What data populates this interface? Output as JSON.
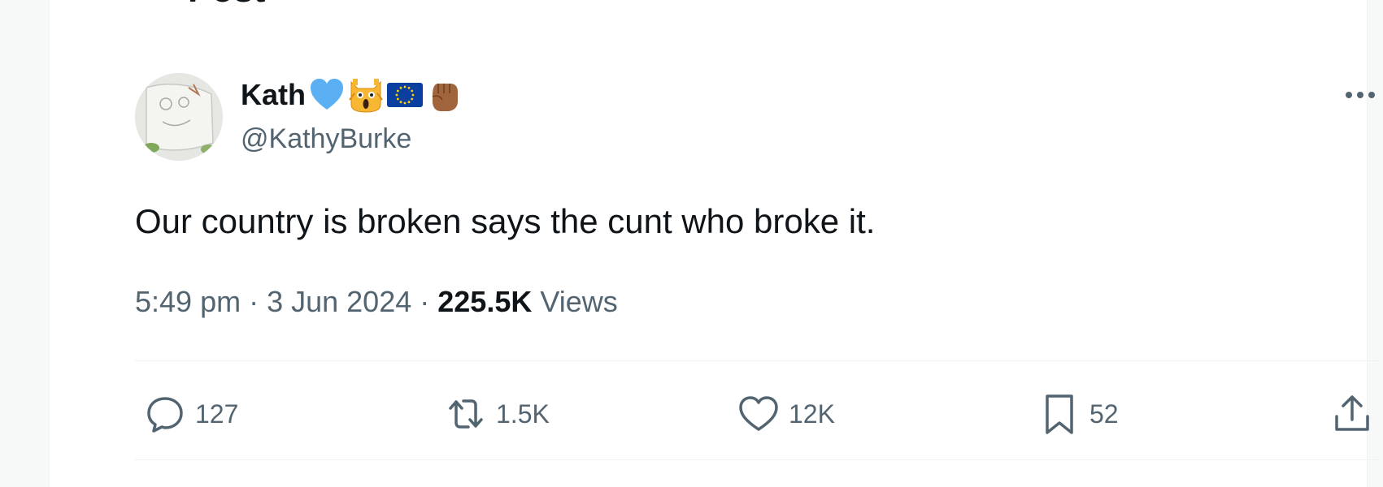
{
  "header": {
    "title": "Post"
  },
  "author": {
    "name": "Kath",
    "handle": "@KathyBurke",
    "badges": [
      "blue-heart-icon",
      "screaming-cat-icon",
      "eu-flag-icon",
      "raised-fist-icon"
    ]
  },
  "tweet": {
    "text": "Our country is broken says the cunt who broke it.",
    "time": "5:49 pm",
    "date": "3 Jun 2024",
    "views_count": "225.5K",
    "views_label": "Views"
  },
  "actions": {
    "replies": "127",
    "reposts": "1.5K",
    "likes": "12K",
    "bookmarks": "52"
  },
  "colors": {
    "text": "#0f1419",
    "muted": "#536471",
    "divider": "#eff3f4",
    "heart_blue": "#5ab0f2",
    "eu_blue": "#0a3fa0"
  }
}
